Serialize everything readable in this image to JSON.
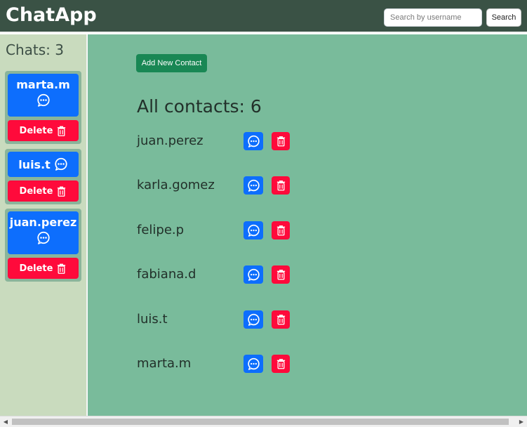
{
  "app": {
    "brand": "ChatApp"
  },
  "search": {
    "placeholder": "Search by username",
    "value": "",
    "button_label": "Search"
  },
  "sidebar": {
    "chats_label": "Chats: 3",
    "chats": [
      {
        "name": "marta.m",
        "delete_label": "Delete"
      },
      {
        "name": "luis.t",
        "delete_label": "Delete"
      },
      {
        "name": "juan.perez",
        "delete_label": "Delete"
      }
    ]
  },
  "main": {
    "add_contact_label": "Add New Contact",
    "contacts_heading": "All contacts: 6",
    "contacts": [
      {
        "name": "juan.perez"
      },
      {
        "name": "karla.gomez"
      },
      {
        "name": "felipe.p"
      },
      {
        "name": "fabiana.d"
      },
      {
        "name": "luis.t"
      },
      {
        "name": "marta.m"
      }
    ]
  },
  "colors": {
    "navbar": "#3a5245",
    "sidebar": "#c9dbbe",
    "main": "#79bb9b",
    "primary": "#0d6efd",
    "danger": "#ff0a3b",
    "success": "#198754"
  },
  "icons": {
    "chat": "chat-dots-icon",
    "delete": "trash-icon"
  }
}
